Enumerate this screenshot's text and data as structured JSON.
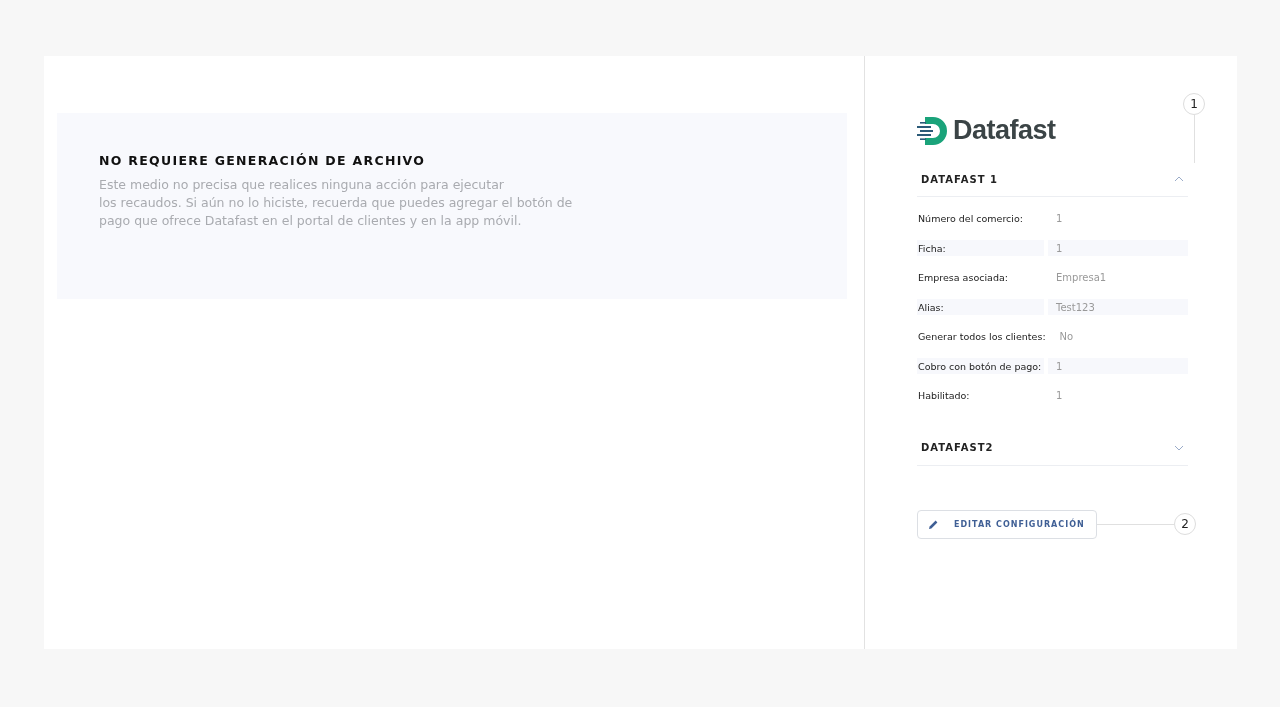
{
  "notice": {
    "title": "NO REQUIERE GENERACIÓN DE ARCHIVO",
    "text": "Este medio no precisa que realices ninguna acción para ejecutar\nlos recaudos. Si aún no lo hiciste, recuerda que puedes agregar el botón de\npago que ofrece Datafast en el portal de clientes y en la app móvil."
  },
  "logo": {
    "text": "Datafast"
  },
  "sections": [
    {
      "title": "DATAFAST 1",
      "expanded": true,
      "fields": [
        {
          "label": "Número del comercio:",
          "value": "1"
        },
        {
          "label": "Ficha:",
          "value": "1"
        },
        {
          "label": "Empresa asociada:",
          "value": "Empresa1"
        },
        {
          "label": "Alias:",
          "value": "Test123"
        },
        {
          "label": "Generar todos los clientes:",
          "value": "No"
        },
        {
          "label": "Cobro con botón de pago:",
          "value": "1"
        },
        {
          "label": "Habilitado:",
          "value": "1"
        }
      ]
    },
    {
      "title": "DATAFAST2",
      "expanded": false
    }
  ],
  "edit_button": {
    "label": "EDITAR CONFIGURACIÓN"
  },
  "callouts": [
    "1",
    "2"
  ]
}
